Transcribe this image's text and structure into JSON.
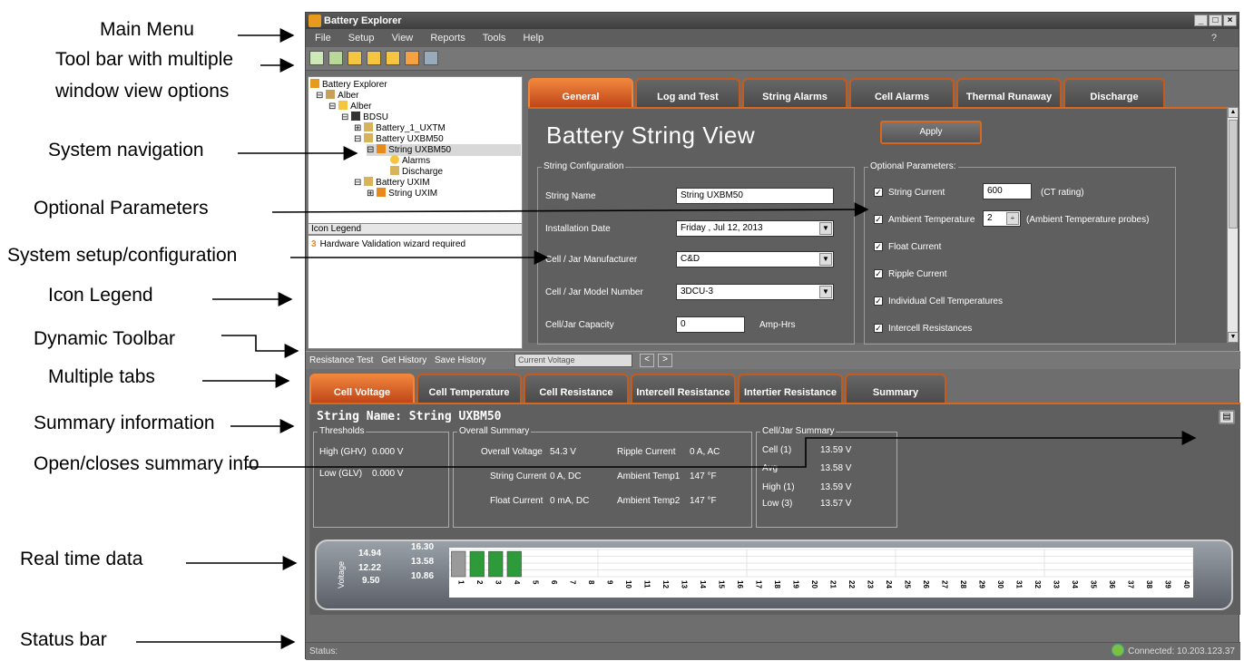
{
  "annotations": {
    "main_menu": "Main Menu",
    "toolbar_line1": "Tool bar with multiple",
    "toolbar_line2": "window view options",
    "system_navigation": "System navigation",
    "optional_parameters": "Optional Parameters",
    "system_setup": "System setup/configuration",
    "icon_legend": "Icon Legend",
    "dynamic_toolbar": "Dynamic Toolbar",
    "multiple_tabs": "Multiple tabs",
    "summary_information": "Summary information",
    "open_closes": "Open/closes summary info",
    "real_time_data": "Real time data",
    "status_bar": "Status bar"
  },
  "app": {
    "title": "Battery Explorer",
    "window_buttons": [
      "_",
      "□",
      "×"
    ]
  },
  "menu": {
    "items": [
      "File",
      "Setup",
      "View",
      "Reports",
      "Tools",
      "Help"
    ],
    "help_q": "?"
  },
  "tree": {
    "root": "Battery Explorer",
    "alber1": "Alber",
    "alber2": "Alber",
    "bdsu": "BDSU",
    "battery1": "Battery_1_UXTM",
    "battery_uxbm": "Battery UXBM50",
    "string_uxbm": "String UXBM50",
    "alarms": "Alarms",
    "discharge": "Discharge",
    "battery_uxim": "Battery UXIM",
    "string_uxim": "String UXIM"
  },
  "legend": {
    "header": "Icon Legend",
    "item_number": "3",
    "item": "Hardware Validation wizard required"
  },
  "tabs_top": [
    "General",
    "Log and Test",
    "String Alarms",
    "Cell Alarms",
    "Thermal Runaway",
    "Discharge"
  ],
  "general": {
    "title": "Battery String View",
    "apply": "Apply",
    "string_config": {
      "legend": "String Configuration",
      "string_name_label": "String Name",
      "string_name_value": "String UXBM50",
      "install_date_label": "Installation Date",
      "install_date_value": "Friday    ,  Jul  12, 2013",
      "manufacturer_label": "Cell / Jar Manufacturer",
      "manufacturer_value": "C&D",
      "model_label": "Cell / Jar Model Number",
      "model_value": "3DCU-3",
      "capacity_label": "Cell/Jar Capacity",
      "capacity_value": "0",
      "capacity_unit": "Amp-Hrs"
    },
    "optional": {
      "legend": "Optional Parameters:",
      "string_current": "String Current",
      "string_current_value": "600",
      "ct_rating": "(CT rating)",
      "ambient_temp": "Ambient Temperature",
      "ambient_temp_value": "2",
      "ambient_probes": "(Ambient Temperature probes)",
      "float_current": "Float Current",
      "ripple_current": "Ripple Current",
      "individual_temps": "Individual Cell Temperatures",
      "intercell_res": "Intercell Resistances"
    }
  },
  "dyn_toolbar": {
    "resistance_test": "Resistance Test",
    "get_history": "Get History",
    "save_history": "Save History",
    "select_value": "Current Voltage",
    "prev": "<",
    "next": ">"
  },
  "tabs_bottom": [
    "Cell Voltage",
    "Cell Temperature",
    "Cell Resistance",
    "Intercell Resistance",
    "Intertier Resistance",
    "Summary"
  ],
  "summary": {
    "string_name": "String Name: String UXBM50",
    "thresholds": {
      "legend": "Thresholds",
      "high_label": "High (GHV)",
      "high_value": "0.000 V",
      "low_label": "Low (GLV)",
      "low_value": "0.000 V"
    },
    "overall": {
      "legend": "Overall Summary",
      "overall_voltage_label": "Overall Voltage",
      "overall_voltage_value": "54.3 V",
      "ripple_current_label": "Ripple Current",
      "ripple_current_value": "0 A, AC",
      "string_current_label": "String Current",
      "string_current_value": "0 A, DC",
      "ambient1_label": "Ambient Temp1",
      "ambient1_value": "147 °F",
      "float_current_label": "Float Current",
      "float_current_value": "0 mA, DC",
      "ambient2_label": "Ambient Temp2",
      "ambient2_value": "147 °F"
    },
    "cell_summary": {
      "legend": "Cell/Jar Summary",
      "cell1_label": "Cell (1)",
      "cell1_value": "13.59 V",
      "avg_label": "Avg",
      "avg_value": "13.58 V",
      "high_label": "High (1)",
      "high_value": "13.59 V",
      "low_label": "Low (3)",
      "low_value": "13.57 V"
    }
  },
  "chart_data": {
    "type": "bar",
    "ylabel": "Voltage",
    "left_ticks": [
      "14.94",
      "12.22",
      "9.50"
    ],
    "right_ticks": [
      "16.30",
      "13.58",
      "10.86"
    ],
    "categories": [
      "1",
      "2",
      "3",
      "4",
      "5",
      "6",
      "7",
      "8",
      "9",
      "10",
      "11",
      "12",
      "13",
      "14",
      "15",
      "16",
      "17",
      "18",
      "19",
      "20",
      "21",
      "22",
      "23",
      "24",
      "25",
      "26",
      "27",
      "28",
      "29",
      "30",
      "31",
      "32",
      "33",
      "34",
      "35",
      "36",
      "37",
      "38",
      "39",
      "40"
    ],
    "values": [
      13.59,
      13.58,
      13.57,
      13.58
    ],
    "ylim": [
      9.5,
      16.3
    ],
    "colors": {
      "cell1": "#9a9a9a",
      "others": "#2e9b3a"
    }
  },
  "status": {
    "label": "Status:",
    "connected": "Connected: 10.203.123.37"
  }
}
